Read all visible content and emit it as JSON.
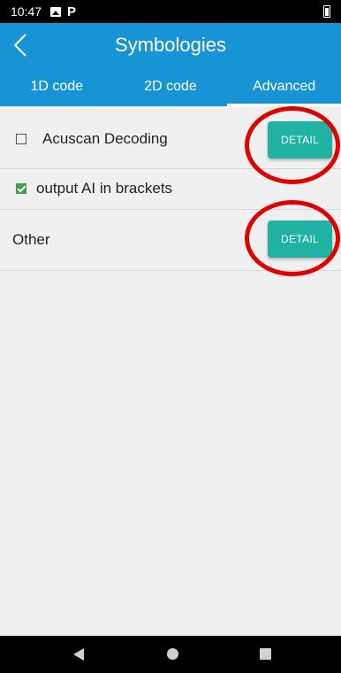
{
  "status_bar": {
    "time": "10:47",
    "icons": [
      "image-icon",
      "parking-icon",
      "battery-icon"
    ],
    "p_glyph": "P"
  },
  "app_bar": {
    "title": "Symbologies",
    "back_icon": "chevron-left-icon"
  },
  "tabs": [
    {
      "label": "1D code",
      "active": false
    },
    {
      "label": "2D code",
      "active": false
    },
    {
      "label": "Advanced",
      "active": true
    }
  ],
  "rows": {
    "acuscan": {
      "label": "Acuscan Decoding",
      "checked": false,
      "button": "DETAIL"
    },
    "brackets": {
      "label": "output AI in brackets",
      "checked": true
    },
    "other": {
      "label": "Other",
      "button": "DETAIL"
    }
  },
  "colors": {
    "app_bar": "#1794d6",
    "detail_button": "#20b3a3",
    "checkbox_checked": "#43a047",
    "highlight_ring": "#e00000",
    "background": "#f0f0f0"
  },
  "nav_bar": {
    "icons": [
      "back-triangle-icon",
      "home-circle-icon",
      "recent-square-icon"
    ]
  }
}
